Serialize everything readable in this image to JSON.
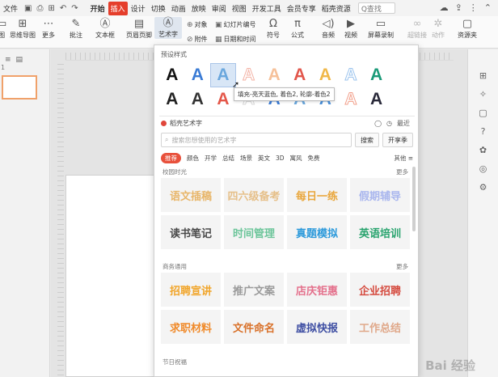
{
  "menu": {
    "file_label": "文件",
    "tabs": [
      {
        "label": "开始",
        "active": false,
        "bold": true
      },
      {
        "label": "插入",
        "active": true,
        "bold": false
      },
      {
        "label": "设计",
        "active": false,
        "bold": false
      },
      {
        "label": "切换",
        "active": false,
        "bold": false
      },
      {
        "label": "动画",
        "active": false,
        "bold": false
      },
      {
        "label": "放映",
        "active": false,
        "bold": false
      },
      {
        "label": "审阅",
        "active": false,
        "bold": false
      },
      {
        "label": "视图",
        "active": false,
        "bold": false
      },
      {
        "label": "开发工具",
        "active": false,
        "bold": false
      },
      {
        "label": "会员专享",
        "active": false,
        "bold": false
      },
      {
        "label": "稻壳资源",
        "active": false,
        "bold": false
      }
    ],
    "search_label": "Q查找"
  },
  "ribbon": {
    "image_label": "图",
    "mindmap_label": "思维导图",
    "more_label": "更多",
    "comment_label": "批注",
    "textbox_label": "文本框",
    "header_footer_label": "页眉页脚",
    "wordart_label": "艺术字",
    "object_label": "对象",
    "attachment_label": "附件",
    "slide_number_label": "幻灯片编号",
    "datetime_label": "日期和时间",
    "symbol_label": "符号",
    "formula_label": "公式",
    "audio_label": "音频",
    "video_label": "视频",
    "screen_record_label": "屏幕录制",
    "hyperlink_label": "超链接",
    "action_label": "动作",
    "resource_label": "资源夹"
  },
  "slides_panel": {
    "slide_number": "1"
  },
  "wordart_panel": {
    "preset_heading": "预设样式",
    "preset_glyph": "A",
    "preset_colors_row1": [
      "#111111",
      "#3a7bd5",
      "#6aa7dd",
      "#f3b3a6",
      "#f6c19a",
      "#e2574c",
      "#f0b84a",
      "#9cc4ee",
      "#1a9a78"
    ],
    "preset_colors_row2": [
      "#222222",
      "#333333",
      "#e4574a",
      "#d9d9d9",
      "#3a7bd5",
      "#6aa7dd",
      "#4a90d9",
      "#f2a08c",
      "#2a2a3a"
    ],
    "tooltip": "填充-亮天蓝色, 着色2, 轮廓-着色2",
    "art_title": "稻壳艺术字",
    "art_right_labels": [
      "",
      "最近"
    ],
    "search_placeholder": "搜索您想使用的艺术字",
    "search_button": "搜索",
    "open_member_button": "开享季",
    "categories": [
      "推荐",
      "颜色",
      "开学",
      "总结",
      "场景",
      "英文",
      "3D",
      "寓风",
      "免费"
    ],
    "categories_more": "其他 ≡",
    "sections": [
      {
        "title": "校园时光",
        "more": "更多",
        "tiles": [
          {
            "text": "语文插稿",
            "color": "#e8b66a"
          },
          {
            "text": "四六级备考",
            "color": "#e6c08a"
          },
          {
            "text": "每日一练",
            "color": "#e9a73d"
          },
          {
            "text": "假期辅导",
            "color": "#a9b6ee"
          },
          {
            "text": "读书笔记",
            "color": "#4a4a4a"
          },
          {
            "text": "时间管理",
            "color": "#6cc59a"
          },
          {
            "text": "真题模拟",
            "color": "#2d9adb"
          },
          {
            "text": "英语培训",
            "color": "#27a36d"
          }
        ]
      },
      {
        "title": "商务通用",
        "more": "更多",
        "tiles": [
          {
            "text": "招聘宣讲",
            "color": "#f1a52a"
          },
          {
            "text": "推广文案",
            "color": "#9a9a9a"
          },
          {
            "text": "店庆钜惠",
            "color": "#e4708c"
          },
          {
            "text": "企业招聘",
            "color": "#d54a3e"
          },
          {
            "text": "求职材料",
            "color": "#f08a2a"
          },
          {
            "text": "文件命名",
            "color": "#d9712a"
          },
          {
            "text": "虚拟快报",
            "color": "#3f4fa3"
          },
          {
            "text": "工作总结",
            "color": "#e0a88a"
          }
        ]
      }
    ],
    "third_section_title": "节日祝福"
  },
  "watermark": "Bai 经验"
}
